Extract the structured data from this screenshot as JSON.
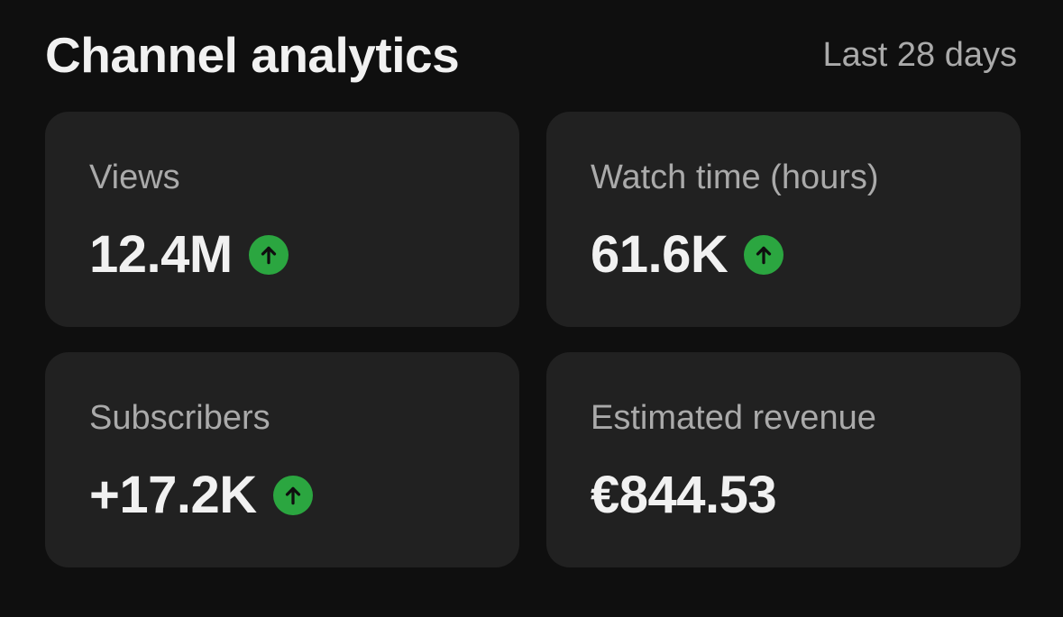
{
  "header": {
    "title": "Channel analytics",
    "period": "Last 28 days"
  },
  "metrics": [
    {
      "label": "Views",
      "value": "12.4M",
      "trend": "up",
      "trend_icon": "arrow-up-icon"
    },
    {
      "label": "Watch time (hours)",
      "value": "61.6K",
      "trend": "up",
      "trend_icon": "arrow-up-icon"
    },
    {
      "label": "Subscribers",
      "value": "+17.2K",
      "trend": "up",
      "trend_icon": "arrow-up-icon"
    },
    {
      "label": "Estimated revenue",
      "value": "€844.53",
      "trend": "none"
    }
  ],
  "colors": {
    "background": "#0f0f0f",
    "card": "#212121",
    "primary_text": "#f1f1f1",
    "secondary_text": "#aaaaaa",
    "trend_up": "#2ba640"
  }
}
